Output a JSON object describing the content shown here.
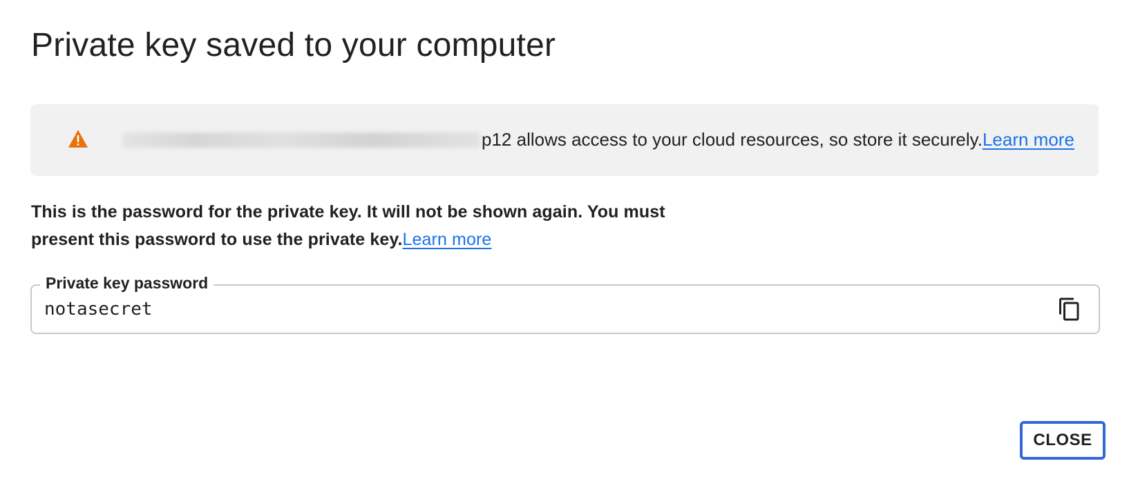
{
  "dialog": {
    "title": "Private key saved to your computer",
    "banner": {
      "icon": "warning-icon",
      "icon_color": "#e8710a",
      "file_suffix": "p12 allows access to your cloud resources, so store it securely.",
      "learn_more": "Learn more"
    },
    "description": {
      "text": "This is the password for the private key. It will not be shown again. You must present this password to use the private key.",
      "learn_more": "Learn more"
    },
    "password_field": {
      "label": "Private key password",
      "value": "notasecret",
      "copy_icon": "copy-icon"
    },
    "close_button": "CLOSE"
  },
  "colors": {
    "link": "#1a73e8",
    "banner_bg": "#f1f1f1",
    "focus_border": "#3367d6"
  }
}
